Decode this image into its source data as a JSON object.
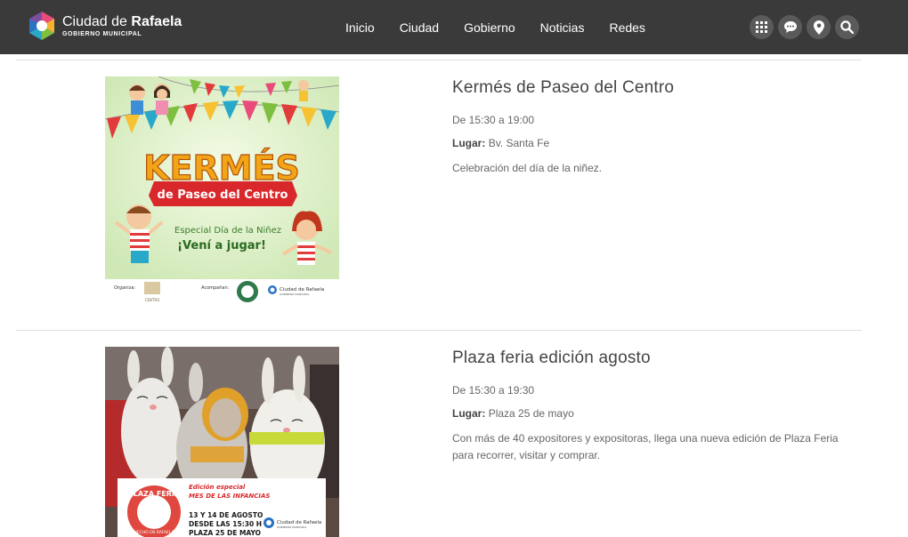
{
  "header": {
    "logo_title_light": "Ciudad de ",
    "logo_title_bold": "Rafaela",
    "logo_subtitle": "GOBIERNO MUNICIPAL",
    "nav": [
      "Inicio",
      "Ciudad",
      "Gobierno",
      "Noticias",
      "Redes"
    ],
    "icons": [
      "apps-grid-icon",
      "chat-bubble-icon",
      "location-pin-icon",
      "search-icon"
    ]
  },
  "events": [
    {
      "title": "Kermés de Paseo del Centro",
      "time": "De 15:30 a 19:00",
      "place_label": "Lugar:",
      "place": "Bv. Santa Fe",
      "description": "Celebración del día de la niñez.",
      "poster": {
        "headline": "KERMÉS",
        "ribbon": "de Paseo del Centro",
        "special": "Especial Día de la Niñez",
        "cta": "¡Vení a jugar!",
        "organiza": "Organiza:",
        "acompanan": "Acompañan:",
        "brand": "Ciudad de Rafaela",
        "brand_sub": "GOBIERNO MUNICIPAL",
        "org_logo": "CENTRO"
      }
    },
    {
      "title": "Plaza feria edición agosto",
      "time": "De 15:30 a 19:30",
      "place_label": "Lugar:",
      "place": "Plaza 25 de mayo",
      "description": "Con más de 40 expositores y expositoras, llega una nueva edición de Plaza Feria para recorrer, visitar y comprar.",
      "poster": {
        "badge_top": "PLAZA FERIA",
        "badge_bottom": "HECHO EN RAFAELA",
        "edition": "Edición especial",
        "edition_sub": "MES DE LAS INFANCIAS",
        "dates_1": "13 Y 14 DE AGOSTO",
        "dates_2": "DESDE LAS 15:30 H",
        "dates_3": "PLAZA 25 DE MAYO",
        "brand": "Ciudad de Rafaela",
        "brand_sub": "GOBIERNO MUNICIPAL"
      }
    }
  ]
}
